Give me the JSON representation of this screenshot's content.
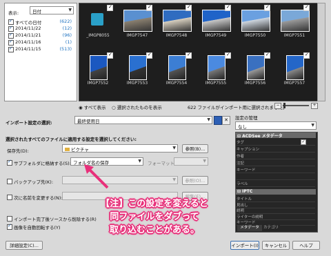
{
  "filter": {
    "label": "表示:",
    "select_value": "日付"
  },
  "dates": [
    {
      "label": "すべての日付",
      "count": "(622)"
    },
    {
      "label": "2014/11/22",
      "count": "(12)"
    },
    {
      "label": "2014/11/21",
      "count": "(96)"
    },
    {
      "label": "2014/11/16",
      "count": "(1)"
    },
    {
      "label": "2014/11/15",
      "count": "(513)"
    }
  ],
  "thumbnails_row1": [
    "_IMGP8055",
    "IMGP7547",
    "IMGP7548",
    "IMGP7549",
    "IMGP7550",
    "IMGP7551"
  ],
  "thumbnails_row2": [
    "IMGP7552",
    "IMGP7553",
    "IMGP7554",
    "IMGP7555",
    "IMGP7556",
    "IMGP7557"
  ],
  "view": {
    "show_all": "すべて表示",
    "show_selected": "選択されたものを表示",
    "status": "622 ファイルがインポート用に選択されました。"
  },
  "settings": {
    "label": "インポート設定の選択:",
    "select_value": "最終使用日",
    "apply_label": "選択されたすべてのファイルに適用する設定を選択してください:",
    "save_to_label": "保存先(D):",
    "save_to_value": "ピクチャ",
    "browse1": "参照(B)...",
    "subfolder_label": "サブフォルダに格納する(S):",
    "subfolder_value": "フォルダ名の保存",
    "format_label": "フォーマット:",
    "backup_label": "バックアップ先(K):",
    "browse2": "参照(O)...",
    "rename_label": "次に名前を変更する(N):",
    "browse3": "編集(E)...",
    "delete_label": "インポート完了後ソースから削除する(R)",
    "rotate_label": "画像を自動回転する(Y)"
  },
  "annotation": {
    "line1": "【注】この設定を変えると",
    "line2": "同ファイルをダブって",
    "line3": "取り込むことがある。"
  },
  "meta": {
    "manage_label": "設定の管理",
    "manage_value": "なし",
    "acdsee_header": "ACDSee メタデータ",
    "acdsee_rows": [
      "タグ",
      "キャプション",
      "作者",
      "注記",
      "キーワード",
      "",
      "ラベル"
    ],
    "iptc_header": "IPTC",
    "iptc_rows": [
      "タイトル",
      "見出し",
      "説明",
      "ライターの説明",
      "キーワード"
    ],
    "tab_metadata": "メタデータ",
    "tab_category": "カテゴリ"
  },
  "buttons": {
    "advanced": "詳細設定(C)...",
    "import": "インポート(I)",
    "cancel": "キャンセル",
    "help": "ヘルプ"
  },
  "colors": {
    "accent": "#e8307a",
    "select_blue": "#215a9a"
  }
}
